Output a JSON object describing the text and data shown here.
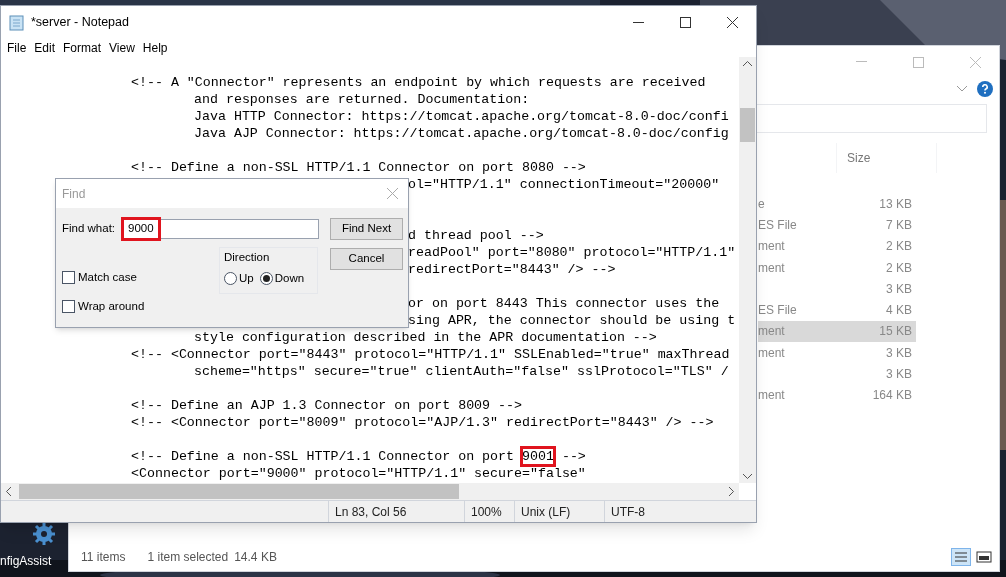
{
  "desktop": {
    "icon_label": "nfigAssist"
  },
  "explorer": {
    "column_header": "Size",
    "rows": [
      {
        "type": "e",
        "size": "13 KB",
        "selected": false
      },
      {
        "type": "ES File",
        "size": "7 KB",
        "selected": false
      },
      {
        "type": "ment",
        "size": "2 KB",
        "selected": false
      },
      {
        "type": "ment",
        "size": "2 KB",
        "selected": false
      },
      {
        "size": "3 KB",
        "selected": false
      },
      {
        "type": "ES File",
        "size": "4 KB",
        "selected": false
      },
      {
        "type": "ment",
        "size": "15 KB",
        "selected": true
      },
      {
        "type": "ment",
        "size": "3 KB",
        "selected": false
      },
      {
        "size": "3 KB",
        "selected": false
      },
      {
        "type": "ment",
        "size": "164 KB",
        "selected": false
      }
    ],
    "status": [
      "11 items",
      "1 item selected",
      "14.4 KB"
    ]
  },
  "notepad": {
    "title": "*server - Notepad",
    "menu": [
      "File",
      "Edit",
      "Format",
      "View",
      "Help"
    ],
    "lines": [
      {
        "kind": "outer",
        "text": "<!-- A \"Connector\" represents an endpoint by which requests are received"
      },
      {
        "kind": "inner",
        "text": "and responses are returned. Documentation:"
      },
      {
        "kind": "inner",
        "text": "Java HTTP Connector: https://tomcat.apache.org/tomcat-8.0-doc/confi"
      },
      {
        "kind": "inner",
        "text": "Java AJP Connector: https://tomcat.apache.org/tomcat-8.0-doc/config"
      },
      {
        "kind": "blank"
      },
      {
        "kind": "outer",
        "text": "<!-- Define a non-SSL HTTP/1.1 Connector on port 8080 -->"
      },
      {
        "kind": "fragment",
        "text": "ol=\"HTTP/1.1\" connectionTimeout=\"20000\""
      },
      {
        "kind": "blank"
      },
      {
        "kind": "blank"
      },
      {
        "kind": "fragment",
        "text": "d thread pool -->"
      },
      {
        "kind": "fragment",
        "text": "readPool\" port=\"8080\" protocol=\"HTTP/1.1\""
      },
      {
        "kind": "fragment",
        "text": "redirectPort=\"8443\" /> -->"
      },
      {
        "kind": "blank"
      },
      {
        "kind": "fragment",
        "text": "or on port 8443 This connector uses the"
      },
      {
        "kind": "fragment",
        "text": "sing APR, the connector should be using t"
      },
      {
        "kind": "inner",
        "text": "style configuration described in the APR documentation -->"
      },
      {
        "kind": "outer",
        "text": "<!-- <Connector port=\"8443\" protocol=\"HTTP/1.1\" SSLEnabled=\"true\" maxThread"
      },
      {
        "kind": "inner",
        "text": "scheme=\"https\" secure=\"true\" clientAuth=\"false\" sslProtocol=\"TLS\" /"
      },
      {
        "kind": "blank"
      },
      {
        "kind": "outer",
        "text": "<!-- Define an AJP 1.3 Connector on port 8009 -->"
      },
      {
        "kind": "outer",
        "text": "<!-- <Connector port=\"8009\" protocol=\"AJP/1.3\" redirectPort=\"8443\" /> -->"
      },
      {
        "kind": "blank"
      },
      {
        "kind": "outer",
        "text": "<!-- Define a non-SSL HTTP/1.1 Connector on port ",
        "highlight": "9001",
        "after": " -->"
      },
      {
        "kind": "outer",
        "text": "<Connector port=\"9000\" protocol=\"HTTP/1.1\" secure=\"false\""
      }
    ],
    "status": [
      "Ln 83, Col 56",
      "100%",
      "Unix (LF)",
      "UTF-8"
    ]
  },
  "find": {
    "title": "Find",
    "label": "Find what:",
    "value": "9000",
    "buttons": [
      "Find Next",
      "Cancel"
    ],
    "direction": {
      "label": "Direction",
      "options": [
        {
          "label": "Up",
          "selected": false
        },
        {
          "label": "Down",
          "selected": true
        }
      ]
    },
    "options": [
      {
        "label": "Match case",
        "checked": false
      },
      {
        "label": "Wrap around",
        "checked": false
      }
    ]
  }
}
